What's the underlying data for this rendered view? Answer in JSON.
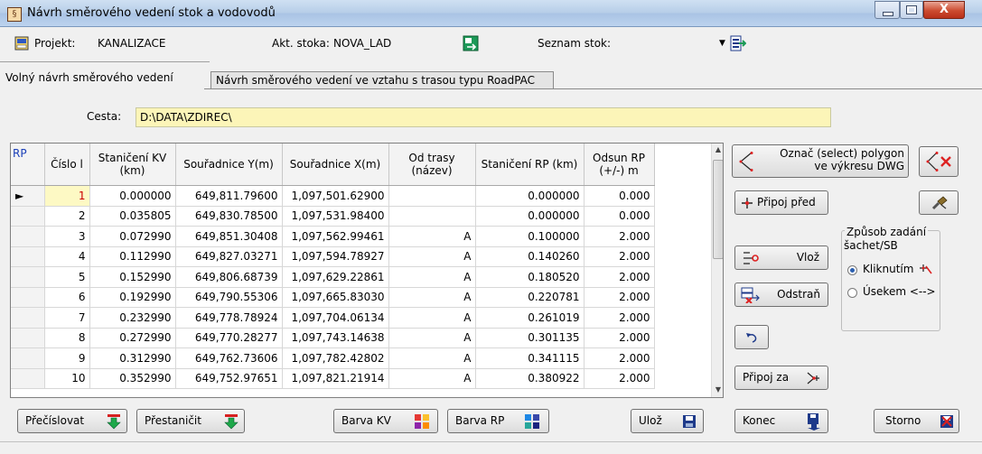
{
  "window": {
    "title": "Návrh směrového vedení stok a vodovodů",
    "close_glyph": "X"
  },
  "toolbar": {
    "projekt_label": "Projekt:",
    "projekt_value": "KANALIZACE",
    "stoka_label": "Akt. stoka:",
    "stoka_value": "NOVA_LAD",
    "seznam_label": "Seznam stok:",
    "seznam_value": ""
  },
  "tabs": [
    {
      "label": "Volný návrh směrového vedení",
      "active": true
    },
    {
      "label": "Návrh směrového vedení ve vztahu s trasou typu RoadPAC",
      "active": false
    }
  ],
  "cesta": {
    "label": "Cesta:",
    "value": "D:\\DATA\\ZDIREC\\"
  },
  "grid": {
    "headers": [
      "RP",
      "Číslo l",
      "Staničení KV (km)",
      "Souřadnice Y(m)",
      "Souřadnice X(m)",
      "Od trasy (název)",
      "Staničení RP (km)",
      "Odsun RP (+/-) m"
    ],
    "current_row_marker": "►",
    "rows": [
      {
        "cislo": "1",
        "kv": "0.000000",
        "y": "649,811.79600",
        "x": "1,097,501.62900",
        "trasa": "",
        "rp": "0.000000",
        "odsun": "0.000"
      },
      {
        "cislo": "2",
        "kv": "0.035805",
        "y": "649,830.78500",
        "x": "1,097,531.98400",
        "trasa": "",
        "rp": "0.000000",
        "odsun": "0.000"
      },
      {
        "cislo": "3",
        "kv": "0.072990",
        "y": "649,851.30408",
        "x": "1,097,562.99461",
        "trasa": "A",
        "rp": "0.100000",
        "odsun": "2.000"
      },
      {
        "cislo": "4",
        "kv": "0.112990",
        "y": "649,827.03271",
        "x": "1,097,594.78927",
        "trasa": "A",
        "rp": "0.140260",
        "odsun": "2.000"
      },
      {
        "cislo": "5",
        "kv": "0.152990",
        "y": "649,806.68739",
        "x": "1,097,629.22861",
        "trasa": "A",
        "rp": "0.180520",
        "odsun": "2.000"
      },
      {
        "cislo": "6",
        "kv": "0.192990",
        "y": "649,790.55306",
        "x": "1,097,665.83030",
        "trasa": "A",
        "rp": "0.220781",
        "odsun": "2.000"
      },
      {
        "cislo": "7",
        "kv": "0.232990",
        "y": "649,778.78924",
        "x": "1,097,704.06134",
        "trasa": "A",
        "rp": "0.261019",
        "odsun": "2.000"
      },
      {
        "cislo": "8",
        "kv": "0.272990",
        "y": "649,770.28277",
        "x": "1,097,743.14638",
        "trasa": "A",
        "rp": "0.301135",
        "odsun": "2.000"
      },
      {
        "cislo": "9",
        "kv": "0.312990",
        "y": "649,762.73606",
        "x": "1,097,782.42802",
        "trasa": "A",
        "rp": "0.341115",
        "odsun": "2.000"
      },
      {
        "cislo": "10",
        "kv": "0.352990",
        "y": "649,752.97651",
        "x": "1,097,821.21914",
        "trasa": "A",
        "rp": "0.380922",
        "odsun": "2.000"
      }
    ]
  },
  "right_panel": {
    "select_polygon_line1": "Označ (select) polygon",
    "select_polygon_line2": "ve výkresu DWG",
    "pripoj_pred": "Připoj před",
    "vloz": "Vlož",
    "odstran": "Odstraň",
    "pripoj_za": "Připoj za",
    "group_title_line1": "Způsob zadání",
    "group_title_line2": "šachet/SB",
    "radio_kliknutim": "Kliknutím",
    "radio_usekem": "Úsekem <-->"
  },
  "bottom": {
    "precislovat": "Přečíslovat",
    "prestanicit": "Přestaničit",
    "barva_kv": "Barva KV",
    "barva_rp": "Barva RP",
    "uloz": "Ulož",
    "konec": "Konec",
    "storno": "Storno"
  },
  "colors": {
    "accent": "#2b5fb0",
    "path_field": "#fcf5b8",
    "selected_cell": "#fdf9c4",
    "down_arrow_green": "#1ea84a",
    "down_arrow_red": "#d62020"
  }
}
